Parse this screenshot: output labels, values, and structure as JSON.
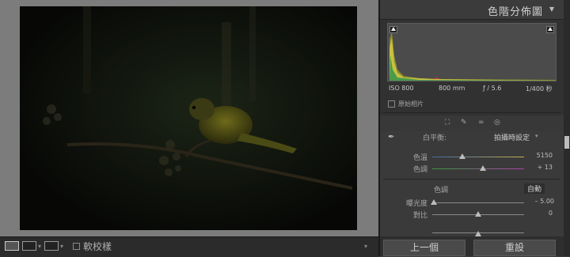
{
  "view_options": {
    "soft_proofing_label": "軟校樣"
  },
  "histogram_panel": {
    "title": "色階分佈圖",
    "iso": "ISO 800",
    "focal_length": "800 mm",
    "aperture": "ƒ / 5.6",
    "shutter": "1/400 秒",
    "original_photo_label": "原始相片"
  },
  "basic_panel": {
    "white_balance_label": "白平衡:",
    "white_balance_value": "拍攝時設定",
    "temp_label": "色溫",
    "temp_value": "5150",
    "tint_label": "色調",
    "tint_value": "+ 13",
    "tone_label": "色調",
    "auto_label": "自動",
    "exposure_label": "曝光度",
    "exposure_value": "– 5.00",
    "contrast_label": "對比",
    "contrast_value": "0"
  },
  "footer": {
    "previous_label": "上一個",
    "reset_label": "重設"
  },
  "colors": {
    "panel_bg": "#3a3a3a",
    "photo_bg": "#0c0e0a",
    "bird_yellow": "#8a8a1a"
  }
}
